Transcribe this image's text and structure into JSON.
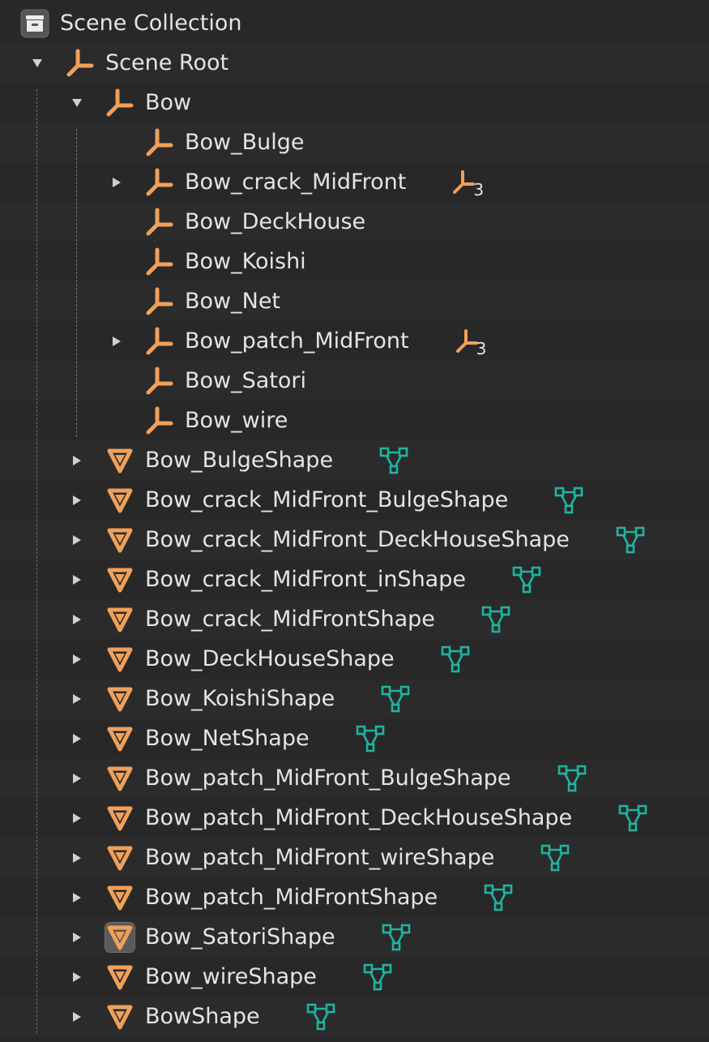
{
  "colors": {
    "background": "#282828",
    "row_alt": "#2b2b2b",
    "text": "#e4e4e4",
    "empty_icon": "#f0a05a",
    "mesh_icon": "#1fb3a0",
    "selected_bg": "#5a5a5a"
  },
  "outliner": {
    "rows": [
      {
        "label": "Scene Collection",
        "depth": -1,
        "icon": "collection-icon",
        "disclosure": "none",
        "extra": null
      },
      {
        "label": "Scene Root",
        "depth": 0,
        "icon": "empty-icon",
        "disclosure": "expanded",
        "extra": null
      },
      {
        "label": "Bow",
        "depth": 1,
        "icon": "empty-icon",
        "disclosure": "expanded",
        "extra": null
      },
      {
        "label": "Bow_Bulge",
        "depth": 2,
        "icon": "empty-icon",
        "disclosure": "none",
        "extra": null
      },
      {
        "label": "Bow_crack_MidFront",
        "depth": 2,
        "icon": "empty-icon",
        "disclosure": "collapsed",
        "extra": {
          "type": "children-empty-icon",
          "count": "3"
        }
      },
      {
        "label": "Bow_DeckHouse",
        "depth": 2,
        "icon": "empty-icon",
        "disclosure": "none",
        "extra": null
      },
      {
        "label": "Bow_Koishi",
        "depth": 2,
        "icon": "empty-icon",
        "disclosure": "none",
        "extra": null
      },
      {
        "label": "Bow_Net",
        "depth": 2,
        "icon": "empty-icon",
        "disclosure": "none",
        "extra": null
      },
      {
        "label": "Bow_patch_MidFront",
        "depth": 2,
        "icon": "empty-icon",
        "disclosure": "collapsed",
        "extra": {
          "type": "children-empty-icon",
          "count": "3"
        }
      },
      {
        "label": "Bow_Satori",
        "depth": 2,
        "icon": "empty-icon",
        "disclosure": "none",
        "extra": null
      },
      {
        "label": "Bow_wire",
        "depth": 2,
        "icon": "empty-icon",
        "disclosure": "none",
        "extra": null
      },
      {
        "label": "Bow_BulgeShape",
        "depth": 1,
        "icon": "mesh-object-icon",
        "disclosure": "collapsed",
        "extra": {
          "type": "mesh-data-icon"
        }
      },
      {
        "label": "Bow_crack_MidFront_BulgeShape",
        "depth": 1,
        "icon": "mesh-object-icon",
        "disclosure": "collapsed",
        "extra": {
          "type": "mesh-data-icon"
        }
      },
      {
        "label": "Bow_crack_MidFront_DeckHouseShape",
        "depth": 1,
        "icon": "mesh-object-icon",
        "disclosure": "collapsed",
        "extra": {
          "type": "mesh-data-icon"
        }
      },
      {
        "label": "Bow_crack_MidFront_inShape",
        "depth": 1,
        "icon": "mesh-object-icon",
        "disclosure": "collapsed",
        "extra": {
          "type": "mesh-data-icon"
        }
      },
      {
        "label": "Bow_crack_MidFrontShape",
        "depth": 1,
        "icon": "mesh-object-icon",
        "disclosure": "collapsed",
        "extra": {
          "type": "mesh-data-icon"
        }
      },
      {
        "label": "Bow_DeckHouseShape",
        "depth": 1,
        "icon": "mesh-object-icon",
        "disclosure": "collapsed",
        "extra": {
          "type": "mesh-data-icon"
        }
      },
      {
        "label": "Bow_KoishiShape",
        "depth": 1,
        "icon": "mesh-object-icon",
        "disclosure": "collapsed",
        "extra": {
          "type": "mesh-data-icon"
        }
      },
      {
        "label": "Bow_NetShape",
        "depth": 1,
        "icon": "mesh-object-icon",
        "disclosure": "collapsed",
        "extra": {
          "type": "mesh-data-icon"
        }
      },
      {
        "label": "Bow_patch_MidFront_BulgeShape",
        "depth": 1,
        "icon": "mesh-object-icon",
        "disclosure": "collapsed",
        "extra": {
          "type": "mesh-data-icon"
        }
      },
      {
        "label": "Bow_patch_MidFront_DeckHouseShape",
        "depth": 1,
        "icon": "mesh-object-icon",
        "disclosure": "collapsed",
        "extra": {
          "type": "mesh-data-icon"
        }
      },
      {
        "label": "Bow_patch_MidFront_wireShape",
        "depth": 1,
        "icon": "mesh-object-icon",
        "disclosure": "collapsed",
        "extra": {
          "type": "mesh-data-icon"
        }
      },
      {
        "label": "Bow_patch_MidFrontShape",
        "depth": 1,
        "icon": "mesh-object-icon",
        "disclosure": "collapsed",
        "extra": {
          "type": "mesh-data-icon"
        }
      },
      {
        "label": "Bow_SatoriShape",
        "depth": 1,
        "icon": "mesh-object-icon",
        "disclosure": "collapsed",
        "selected": true,
        "extra": {
          "type": "mesh-data-icon"
        }
      },
      {
        "label": "Bow_wireShape",
        "depth": 1,
        "icon": "mesh-object-icon",
        "disclosure": "collapsed",
        "extra": {
          "type": "mesh-data-icon"
        }
      },
      {
        "label": "BowShape",
        "depth": 1,
        "icon": "mesh-object-icon",
        "disclosure": "collapsed",
        "extra": {
          "type": "mesh-data-icon"
        }
      }
    ]
  }
}
